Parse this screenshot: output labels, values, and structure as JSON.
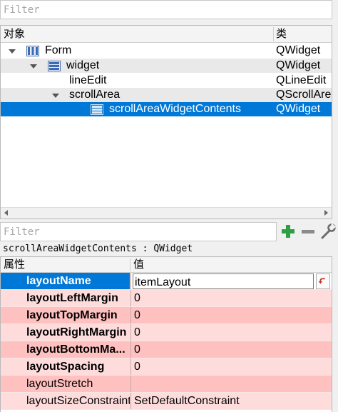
{
  "object_inspector": {
    "filter_placeholder": "Filter",
    "header": {
      "object": "对象",
      "class": "类"
    },
    "rows": [
      {
        "name": "Form",
        "class": "QWidget",
        "icon": "form-layout-icon"
      },
      {
        "name": "widget",
        "class": "QWidget",
        "icon": "widget-layout-icon"
      },
      {
        "name": "lineEdit",
        "class": "QLineEdit"
      },
      {
        "name": "scrollArea",
        "class": "QScrollAre"
      },
      {
        "name": "scrollAreaWidgetContents",
        "class": "QWidget",
        "icon": "vertical-layout-icon"
      }
    ]
  },
  "property_editor": {
    "filter_placeholder": "Filter",
    "add_icon": "plus-icon",
    "remove_icon": "minus-icon",
    "config_icon": "wrench-icon",
    "caption": "scrollAreaWidgetContents : QWidget",
    "header": {
      "property": "属性",
      "value": "值"
    },
    "rows": [
      {
        "name": "layoutName",
        "value": "itemLayout"
      },
      {
        "name": "layoutLeftMargin",
        "value": "0"
      },
      {
        "name": "layoutTopMargin",
        "value": "0"
      },
      {
        "name": "layoutRightMargin",
        "value": "0"
      },
      {
        "name": "layoutBottomMa...",
        "value": "0"
      },
      {
        "name": "layoutSpacing",
        "value": "0"
      },
      {
        "name": "layoutStretch",
        "value": ""
      },
      {
        "name": "layoutSizeConstraint",
        "value": "SetDefaultConstraint"
      }
    ]
  },
  "colors": {
    "selection": "#0078d7",
    "property_light": "#ffdcdc",
    "property_dark": "#ffc0c0",
    "add_green": "#2ea043"
  }
}
